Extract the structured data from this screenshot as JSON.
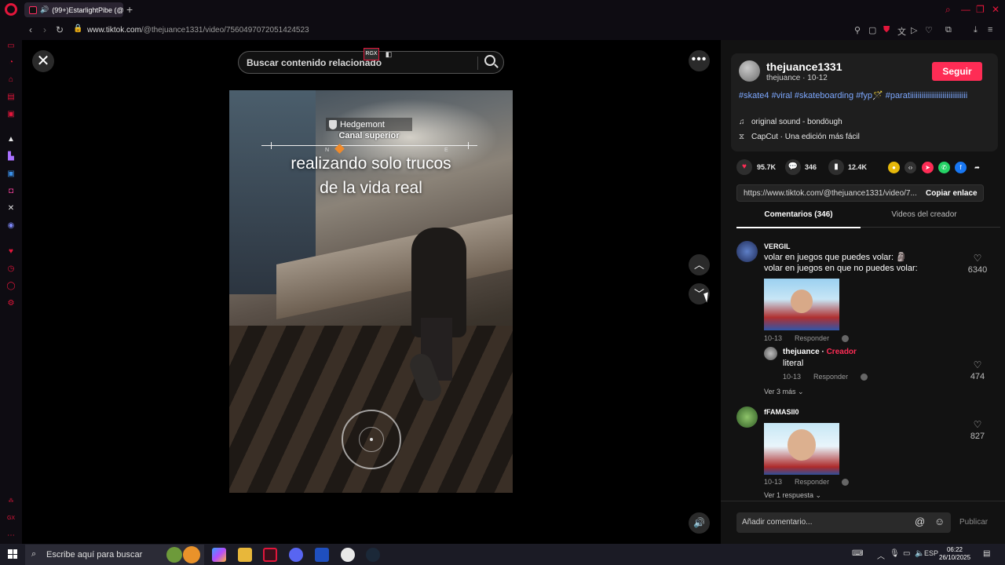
{
  "browser": {
    "tab_title": "(99+)EstarlightPibe (@",
    "url_host": "www.tiktok.com",
    "url_path": "/@thejuance1331/video/7560497072051424523"
  },
  "search": {
    "placeholder": "Buscar contenido relacionado"
  },
  "badges": {
    "rgx": "RGX"
  },
  "video": {
    "hud_location": "Hedgemont",
    "hud_sublocation": "Canal superior",
    "hud_compass_n": "N",
    "hud_compass_e": "E",
    "caption_line1": "realizando solo trucos",
    "caption_line2": "de la vida real"
  },
  "post": {
    "username": "thejuance1331",
    "handle_date": "thejuance · 10-12",
    "follow_label": "Seguir",
    "description": "#skate4 #viral #skateboarding #fyp🪄 #paratiiiiiiiiiiiiiiiiiiiiiiiiiiiiii",
    "sound": "original sound - bondöugh",
    "capcut": "CapCut · Una edición más fácil"
  },
  "actions": {
    "likes": "95.7K",
    "comments": "346",
    "saves": "12.4K"
  },
  "link": {
    "url_text": "https://www.tiktok.com/@thejuance1331/video/7...",
    "copy_label": "Copiar enlace"
  },
  "tabs": {
    "comments": "Comentarios (346)",
    "creator_videos": "Videos del creador"
  },
  "comments": [
    {
      "user": "VERGIL",
      "line1": "volar en juegos que puedes volar: 🗿",
      "line2": "volar en juegos en que no puedes volar:",
      "date": "10-13",
      "reply_label": "Responder",
      "likes": "6340"
    },
    {
      "user": "fFAMASII0",
      "date": "10-13",
      "reply_label": "Responder",
      "likes": "827",
      "more": "Ver 1 respuesta"
    }
  ],
  "reply": {
    "user": "thejuance",
    "creator_tag": "Creador",
    "text": "literal",
    "date": "10-13",
    "reply_label": "Responder",
    "likes": "474",
    "more": "Ver 3 más"
  },
  "comment_bar": {
    "placeholder": "Añadir comentario...",
    "publish_label": "Publicar"
  },
  "taskbar": {
    "search_placeholder": "Escribe aquí para buscar",
    "lang": "ESP",
    "time": "06:22",
    "date": "26/10/2025"
  }
}
